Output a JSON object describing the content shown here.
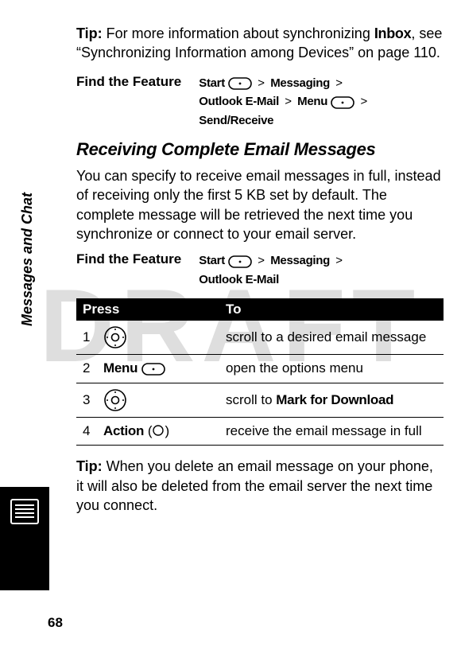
{
  "watermark": "DRAFT",
  "sidebar_label": "Messages and Chat",
  "tip1": {
    "label": "Tip:",
    "before": " For more information about synchronizing ",
    "bold": "Inbox",
    "after": ", see “Synchronizing Information among Devices” on page 110."
  },
  "find1": {
    "label": "Find the Feature",
    "p1_a": "Start",
    "p1_b": "Messaging",
    "p2_a": "Outlook E-Mail",
    "p2_b": "Menu",
    "p2_c": "Send/Receive"
  },
  "section_heading": "Receiving Complete Email Messages",
  "body1": "You can specify to receive email messages in full, instead of receiving only the first 5 KB set by default. The complete message will be retrieved the next time you synchronize or connect to your email server.",
  "find2": {
    "label": "Find the Feature",
    "p1_a": "Start",
    "p1_b": "Messaging",
    "p2_a": "Outlook E-Mail"
  },
  "table": {
    "head_press": "Press",
    "head_to": "To",
    "rows": [
      {
        "n": "1",
        "press_label": "",
        "press_icon": "nav",
        "to_a": "scroll to a desired email message"
      },
      {
        "n": "2",
        "press_label": "Menu",
        "press_icon": "menu",
        "to_a": "open the options menu"
      },
      {
        "n": "3",
        "press_label": "",
        "press_icon": "nav",
        "to_a": "scroll to ",
        "to_bold": "Mark for Download"
      },
      {
        "n": "4",
        "press_label": "Action",
        "press_icon": "action",
        "to_a": "receive the email message in full"
      }
    ]
  },
  "tip2": {
    "label": "Tip:",
    "text": " When you delete an email message on your phone, it will also be deleted from the email server the next time you connect."
  },
  "page_number": "68"
}
